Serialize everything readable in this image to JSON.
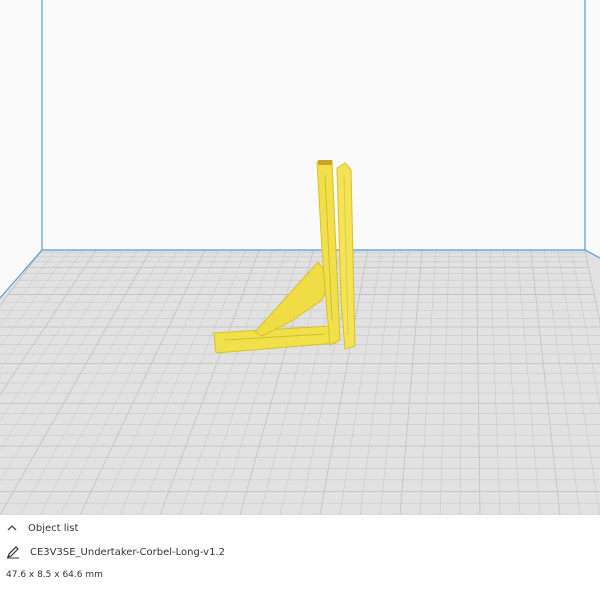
{
  "viewport": {
    "colors": {
      "background": "#fafafa",
      "build_plate": "#e1e1e1",
      "grid_line": "#c4c4c4",
      "volume_edge": "#5b9bd5",
      "model": "#f2e04a",
      "model_shadow": "#d6c12b"
    },
    "model_name": "CE3V3SE_Undertaker-Corbel-Long-v1.2"
  },
  "object_panel": {
    "header_label": "Object list",
    "header_icon": "chevron-up-icon",
    "edit_icon": "pencil-icon",
    "object_name": "CE3V3SE_Undertaker-Corbel-Long-v1.2",
    "dimensions": "47.6 x 8.5 x 64.6 mm"
  }
}
